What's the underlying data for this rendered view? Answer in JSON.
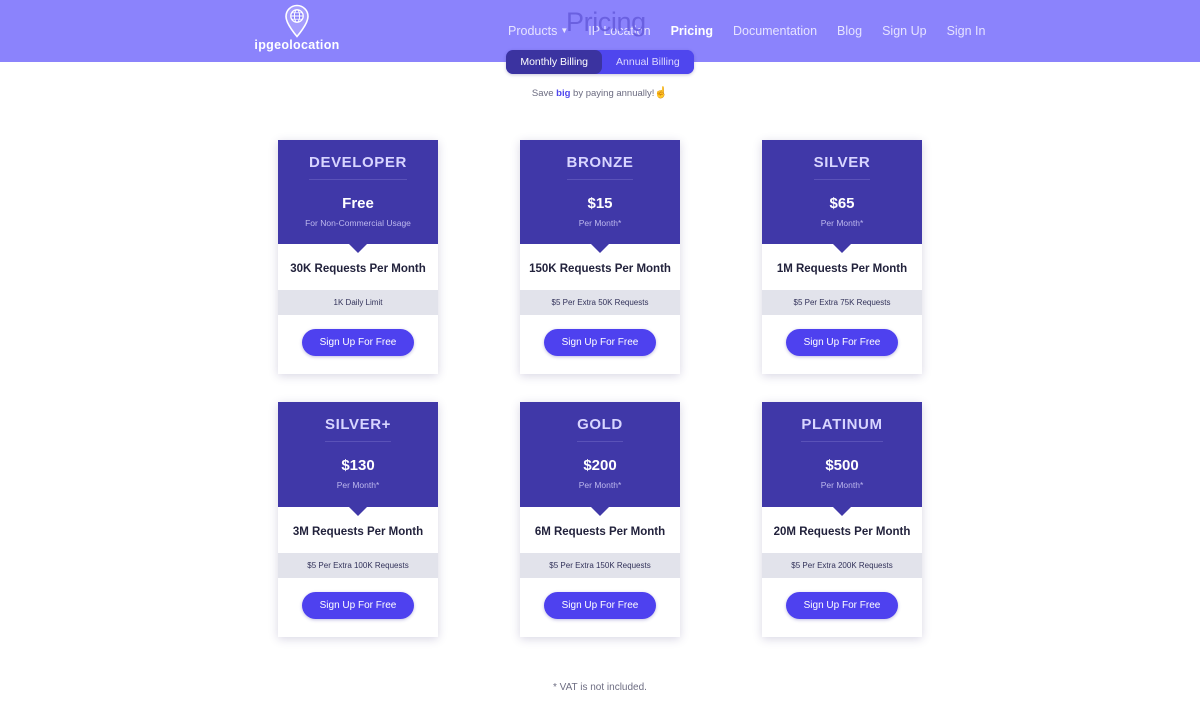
{
  "brand": {
    "name": "ipgeolocation",
    "logo_icon": "map-pin-globe-icon"
  },
  "header": {
    "background": "#8b83fc",
    "nav": [
      {
        "label": "Products",
        "active": false,
        "has_caret": true,
        "caret_icon": "chevron-down-icon"
      },
      {
        "label": "IP Location",
        "active": false,
        "has_caret": false
      },
      {
        "label": "Pricing",
        "active": true,
        "has_caret": false
      },
      {
        "label": "Documentation",
        "active": false,
        "has_caret": false
      },
      {
        "label": "Blog",
        "active": false,
        "has_caret": false
      },
      {
        "label": "Sign Up",
        "active": false,
        "has_caret": false
      },
      {
        "label": "Sign In",
        "active": false,
        "has_caret": false
      }
    ]
  },
  "page": {
    "title": "Pricing"
  },
  "billing": {
    "monthly_label": "Monthly Billing",
    "annual_label": "Annual Billing",
    "selected": "Monthly Billing",
    "note_prefix": "Save ",
    "note_emphasis": "big",
    "note_suffix": " by paying annually!",
    "note_icon": "pointing-up-hand-icon",
    "note_emoji": "☝",
    "active_color": "#3b33a0",
    "track_color": "#4f46ee"
  },
  "plans": [
    {
      "name": "DEVELOPER",
      "price": "Free",
      "period": "For Non-Commercial Usage",
      "requests": "30K Requests Per Month",
      "extra": "1K Daily Limit",
      "cta": "Sign Up For Free"
    },
    {
      "name": "BRONZE",
      "price": "$15",
      "period": "Per Month*",
      "requests": "150K Requests Per Month",
      "extra": "$5 Per Extra 50K Requests",
      "cta": "Sign Up For Free"
    },
    {
      "name": "SILVER",
      "price": "$65",
      "period": "Per Month*",
      "requests": "1M Requests Per Month",
      "extra": "$5 Per Extra 75K Requests",
      "cta": "Sign Up For Free"
    },
    {
      "name": "SILVER+",
      "price": "$130",
      "period": "Per Month*",
      "requests": "3M Requests Per Month",
      "extra": "$5 Per Extra 100K Requests",
      "cta": "Sign Up For Free"
    },
    {
      "name": "GOLD",
      "price": "$200",
      "period": "Per Month*",
      "requests": "6M Requests Per Month",
      "extra": "$5 Per Extra 150K Requests",
      "cta": "Sign Up For Free"
    },
    {
      "name": "PLATINUM",
      "price": "$500",
      "period": "Per Month*",
      "requests": "20M Requests Per Month",
      "extra": "$5 Per Extra 200K Requests",
      "cta": "Sign Up For Free"
    }
  ],
  "footer": {
    "vat_note": "* VAT is not included."
  },
  "colors": {
    "header_purple": "#8b83fc",
    "card_header": "#4038a8",
    "cta_button": "#4e41ef",
    "extra_strip": "#e2e3eb",
    "page_title": "#6a60e0"
  }
}
